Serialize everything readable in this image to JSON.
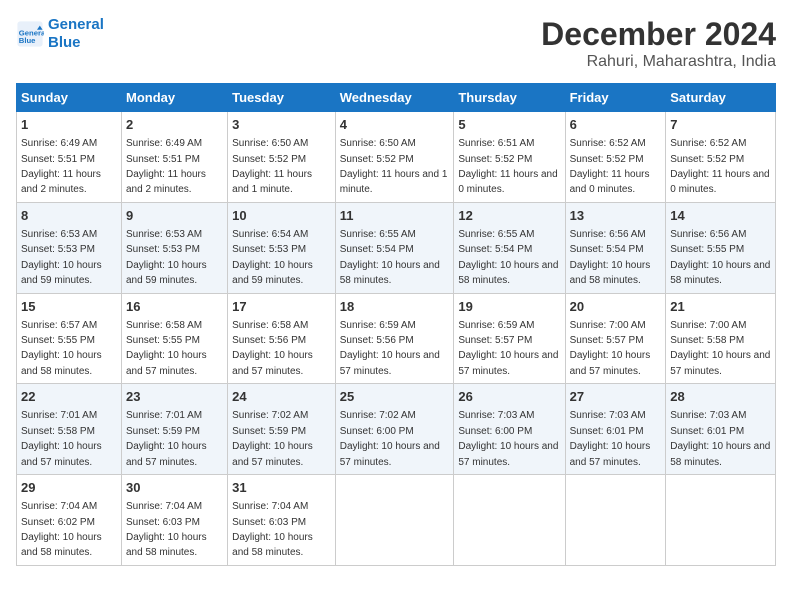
{
  "logo": {
    "line1": "General",
    "line2": "Blue"
  },
  "title": "December 2024",
  "subtitle": "Rahuri, Maharashtra, India",
  "headers": [
    "Sunday",
    "Monday",
    "Tuesday",
    "Wednesday",
    "Thursday",
    "Friday",
    "Saturday"
  ],
  "weeks": [
    [
      {
        "day": "1",
        "sunrise": "6:49 AM",
        "sunset": "5:51 PM",
        "daylight": "11 hours and 2 minutes."
      },
      {
        "day": "2",
        "sunrise": "6:49 AM",
        "sunset": "5:51 PM",
        "daylight": "11 hours and 2 minutes."
      },
      {
        "day": "3",
        "sunrise": "6:50 AM",
        "sunset": "5:52 PM",
        "daylight": "11 hours and 1 minute."
      },
      {
        "day": "4",
        "sunrise": "6:50 AM",
        "sunset": "5:52 PM",
        "daylight": "11 hours and 1 minute."
      },
      {
        "day": "5",
        "sunrise": "6:51 AM",
        "sunset": "5:52 PM",
        "daylight": "11 hours and 0 minutes."
      },
      {
        "day": "6",
        "sunrise": "6:52 AM",
        "sunset": "5:52 PM",
        "daylight": "11 hours and 0 minutes."
      },
      {
        "day": "7",
        "sunrise": "6:52 AM",
        "sunset": "5:52 PM",
        "daylight": "11 hours and 0 minutes."
      }
    ],
    [
      {
        "day": "8",
        "sunrise": "6:53 AM",
        "sunset": "5:53 PM",
        "daylight": "10 hours and 59 minutes."
      },
      {
        "day": "9",
        "sunrise": "6:53 AM",
        "sunset": "5:53 PM",
        "daylight": "10 hours and 59 minutes."
      },
      {
        "day": "10",
        "sunrise": "6:54 AM",
        "sunset": "5:53 PM",
        "daylight": "10 hours and 59 minutes."
      },
      {
        "day": "11",
        "sunrise": "6:55 AM",
        "sunset": "5:54 PM",
        "daylight": "10 hours and 58 minutes."
      },
      {
        "day": "12",
        "sunrise": "6:55 AM",
        "sunset": "5:54 PM",
        "daylight": "10 hours and 58 minutes."
      },
      {
        "day": "13",
        "sunrise": "6:56 AM",
        "sunset": "5:54 PM",
        "daylight": "10 hours and 58 minutes."
      },
      {
        "day": "14",
        "sunrise": "6:56 AM",
        "sunset": "5:55 PM",
        "daylight": "10 hours and 58 minutes."
      }
    ],
    [
      {
        "day": "15",
        "sunrise": "6:57 AM",
        "sunset": "5:55 PM",
        "daylight": "10 hours and 58 minutes."
      },
      {
        "day": "16",
        "sunrise": "6:58 AM",
        "sunset": "5:55 PM",
        "daylight": "10 hours and 57 minutes."
      },
      {
        "day": "17",
        "sunrise": "6:58 AM",
        "sunset": "5:56 PM",
        "daylight": "10 hours and 57 minutes."
      },
      {
        "day": "18",
        "sunrise": "6:59 AM",
        "sunset": "5:56 PM",
        "daylight": "10 hours and 57 minutes."
      },
      {
        "day": "19",
        "sunrise": "6:59 AM",
        "sunset": "5:57 PM",
        "daylight": "10 hours and 57 minutes."
      },
      {
        "day": "20",
        "sunrise": "7:00 AM",
        "sunset": "5:57 PM",
        "daylight": "10 hours and 57 minutes."
      },
      {
        "day": "21",
        "sunrise": "7:00 AM",
        "sunset": "5:58 PM",
        "daylight": "10 hours and 57 minutes."
      }
    ],
    [
      {
        "day": "22",
        "sunrise": "7:01 AM",
        "sunset": "5:58 PM",
        "daylight": "10 hours and 57 minutes."
      },
      {
        "day": "23",
        "sunrise": "7:01 AM",
        "sunset": "5:59 PM",
        "daylight": "10 hours and 57 minutes."
      },
      {
        "day": "24",
        "sunrise": "7:02 AM",
        "sunset": "5:59 PM",
        "daylight": "10 hours and 57 minutes."
      },
      {
        "day": "25",
        "sunrise": "7:02 AM",
        "sunset": "6:00 PM",
        "daylight": "10 hours and 57 minutes."
      },
      {
        "day": "26",
        "sunrise": "7:03 AM",
        "sunset": "6:00 PM",
        "daylight": "10 hours and 57 minutes."
      },
      {
        "day": "27",
        "sunrise": "7:03 AM",
        "sunset": "6:01 PM",
        "daylight": "10 hours and 57 minutes."
      },
      {
        "day": "28",
        "sunrise": "7:03 AM",
        "sunset": "6:01 PM",
        "daylight": "10 hours and 58 minutes."
      }
    ],
    [
      {
        "day": "29",
        "sunrise": "7:04 AM",
        "sunset": "6:02 PM",
        "daylight": "10 hours and 58 minutes."
      },
      {
        "day": "30",
        "sunrise": "7:04 AM",
        "sunset": "6:03 PM",
        "daylight": "10 hours and 58 minutes."
      },
      {
        "day": "31",
        "sunrise": "7:04 AM",
        "sunset": "6:03 PM",
        "daylight": "10 hours and 58 minutes."
      },
      null,
      null,
      null,
      null
    ]
  ],
  "labels": {
    "sunrise": "Sunrise:",
    "sunset": "Sunset:",
    "daylight": "Daylight:"
  }
}
